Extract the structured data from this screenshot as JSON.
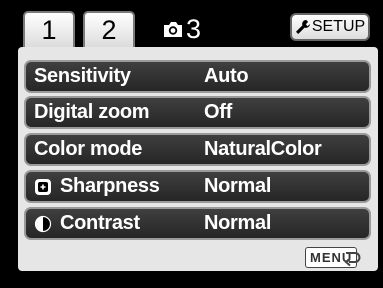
{
  "tabs": [
    {
      "label": "1",
      "selected": false
    },
    {
      "label": "2",
      "selected": false
    },
    {
      "label": "3",
      "icon": "camera-icon",
      "selected": true
    }
  ],
  "setup": {
    "label": "SETUP",
    "icon": "wrench-icon"
  },
  "menu_items": [
    {
      "label": "Sensitivity",
      "value": "Auto"
    },
    {
      "label": "Digital zoom",
      "value": "Off"
    },
    {
      "label": "Color mode",
      "value": "NaturalColor"
    },
    {
      "label": "Sharpness",
      "value": "Normal",
      "icon": "sharpness-icon"
    },
    {
      "label": "Contrast",
      "value": "Normal",
      "icon": "contrast-icon"
    }
  ],
  "footer": {
    "menu_label": "MENU",
    "return_icon": "return-arrow-icon"
  },
  "colors": {
    "background": "#000000",
    "panel": "#e6e6e6",
    "row": "#333333",
    "row_border": "#9a9a9a",
    "tab": "#ffffff"
  }
}
